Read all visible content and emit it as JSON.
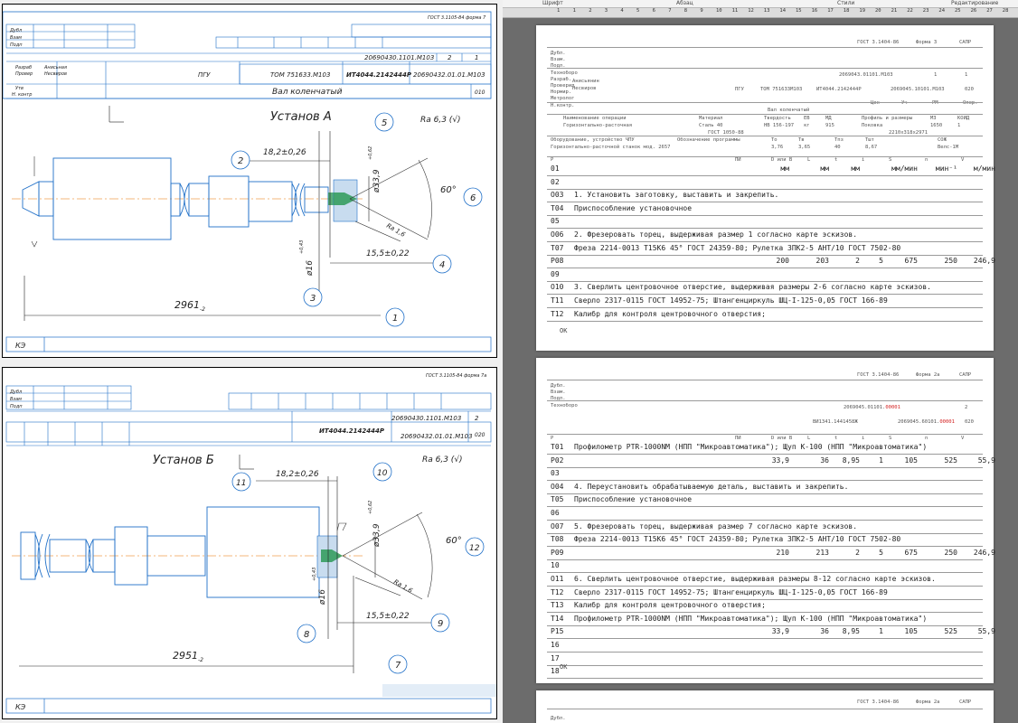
{
  "ribbon": {
    "groups": [
      "Шрифт",
      "Абзац",
      "Стили",
      "Редактирование"
    ]
  },
  "ruler": {
    "marks": [
      "1",
      "1",
      "2",
      "3",
      "4",
      "5",
      "6",
      "7",
      "8",
      "9",
      "10",
      "11",
      "12",
      "13",
      "14",
      "15",
      "16",
      "17",
      "18",
      "19",
      "20",
      "21",
      "22",
      "23",
      "24",
      "25",
      "26",
      "27",
      "28"
    ]
  },
  "sheet_a": {
    "gost": "ГОСТ 3.1105-84 форма 7",
    "stamp_left": [
      "Дубл",
      "Взам",
      "Подп"
    ],
    "doc_number": "20690430.1101.М103",
    "sheet_no": "2",
    "sheet_total": "1",
    "roles": [
      "Разраб",
      "Провер",
      "Утв",
      "Н. контр"
    ],
    "names": [
      "Анисьная",
      "Несвиров"
    ],
    "org": "ПГУ",
    "code1": "ТОМ 751633.М103",
    "code2": "ИТ4044.2142444Р",
    "code3": "20690432.01.01.М103",
    "part_name": "Вал коленчатый",
    "part_code": "010",
    "setup_title": "Установ А",
    "roughness": "Ra 6,3 (√)",
    "dims": {
      "d1": "18,2±0,26",
      "d2": "15,5±0,22",
      "d3": "2961",
      "d3_tol": "-2",
      "dia1": "ø33,9",
      "dia1_tol": "+0,62",
      "dia2": "ø16",
      "dia2_tol": "+0,43",
      "angle": "60°",
      "ra": "Ra 1,6"
    },
    "balloons": [
      "5",
      "2",
      "6",
      "4",
      "3",
      "1"
    ],
    "footer": "КЭ"
  },
  "sheet_b": {
    "gost": "ГОСТ 3.1105-84 форма 7а",
    "stamp_left": [
      "Дубл",
      "Взам",
      "Подп"
    ],
    "doc_number": "20690430.1101.М103",
    "sheet_no": "2",
    "code2": "ИТ4044.2142444Р",
    "code3": "20690432.01.01.М103",
    "part_code": "020",
    "setup_title": "Установ Б",
    "roughness": "Ra 6,3 (√)",
    "dims": {
      "d1": "18,2±0,26",
      "d2": "15,5±0,22",
      "d3": "2951",
      "d3_tol": "-2",
      "dia1": "ø33,9",
      "dia1_tol": "+0,62",
      "dia2": "ø16",
      "dia2_tol": "+0,43",
      "angle": "60°",
      "ra": "Ra 1,6"
    },
    "balloons": [
      "10",
      "11",
      "12",
      "9",
      "8",
      "7"
    ],
    "footer": "КЭ"
  },
  "doc_page1": {
    "header": {
      "gost": "ГОСТ 3.1404-86",
      "form": "Форма 3",
      "sapr": "САПР",
      "labels": [
        "Дубл.",
        "Взам.",
        "Подл.",
        "Техноборо",
        "Разраб.",
        "Проверил",
        "Нормир.",
        "Метролог",
        "Н.контр."
      ],
      "people": [
        "Анисьянин",
        "Несвиров"
      ],
      "doc_no": "2069043.01101.М103",
      "sheet": "1",
      "sheets": "1",
      "org": "ПГУ",
      "code1": "ТОМ 751633М103",
      "code2": "ИТ4044.2142444Р",
      "code3": "2069045.10101.М103",
      "op": "020",
      "part": "Вал коленчатый",
      "sub_labels": [
        "Цех",
        "Уч",
        "РМ",
        "Опер."
      ],
      "h1": [
        "Наименование операции",
        "Материал",
        "Твердость",
        "ЕВ",
        "МД",
        "Профиль и размеры",
        "МЗ",
        "КОИД"
      ],
      "v1": [
        "Горизонтально-расточная",
        "Сталь 40",
        "HB 156-197",
        "кг",
        "915",
        "Поковка",
        "1650",
        "1"
      ],
      "gost_mat": "ГОСТ 1050-88",
      "size": "2210x318x2971",
      "h2": [
        "Оборудование, устройство ЧПУ",
        "Обозначение программы",
        "То",
        "Тв",
        "Тпз",
        "Тшт",
        "СОЖ"
      ],
      "v2": [
        "Горизонтально-расточной станок мод. 2657",
        "",
        "3,76",
        "3,65",
        "40",
        "8,67",
        "Велс-1М"
      ],
      "cols": [
        "Р",
        "ПИ",
        "D или В",
        "L",
        "t",
        "i",
        "S",
        "n",
        "V"
      ]
    },
    "rows": [
      {
        "code": "01",
        "text": "",
        "vals": [
          "мм",
          "мм",
          "мм",
          "",
          "мм/мин",
          "мин⁻¹",
          "м/мин"
        ]
      },
      {
        "code": "02",
        "text": "",
        "vals": []
      },
      {
        "code": "О03",
        "text": "1. Установить заготовку, выставить и закрепить.",
        "vals": []
      },
      {
        "code": "Т04",
        "text": "Приспособление установочное",
        "vals": []
      },
      {
        "code": "05",
        "text": "",
        "vals": []
      },
      {
        "code": "О06",
        "text": "2. Фрезеровать торец, выдерживая размер 1 согласно карте эскизов.",
        "vals": []
      },
      {
        "code": "Т07",
        "text": "Фреза 2214-0013 Т15К6 45° ГОСТ 24359-80; Рулетка ЗПК2-5 АНТ/10 ГОСТ 7502-80",
        "vals": []
      },
      {
        "code": "Р08",
        "text": "",
        "vals": [
          "200",
          "203",
          "2",
          "5",
          "675",
          "250",
          "246,9"
        ]
      },
      {
        "code": "09",
        "text": "",
        "vals": []
      },
      {
        "code": "О10",
        "text": "3. Сверлить центровочное отверстие, выдерживая размеры 2-6 согласно карте эскизов.",
        "vals": []
      },
      {
        "code": "Т11",
        "text": "Сверло 2317-0115 ГОСТ 14952-75; Штангенциркуль ШЦ-I-125-0,05 ГОСТ 166-89",
        "vals": []
      },
      {
        "code": "Т12",
        "text": "Калибр для контроля центровочного отверстия;",
        "vals": []
      }
    ],
    "footer": "ОК"
  },
  "doc_page2": {
    "header": {
      "gost": "ГОСТ 3.1404-86",
      "form": "Форма 2а",
      "sapr": "САПР",
      "labels": [
        "Дубл.",
        "Взам.",
        "Подл.",
        "Техноборо"
      ],
      "doc_no_prefix": "2069045.01101.",
      "doc_no_red": "00001",
      "sheet": "2",
      "code2": "ВИ1341.1441458Ж",
      "code3_prefix": "2069045.60101.",
      "code3_red": "00001",
      "op": "020",
      "cols": [
        "Р",
        "ПИ",
        "D или В",
        "L",
        "t",
        "i",
        "S",
        "n",
        "V"
      ]
    },
    "rows": [
      {
        "code": "Т01",
        "text": "Профилометр PTR-1000NM (НПП \"Микроавтоматика\"); Щуп К-100 (НПП \"Микроавтоматика\")",
        "vals": []
      },
      {
        "code": "Р02",
        "text": "",
        "vals": [
          "33,9",
          "36",
          "8,95",
          "1",
          "105",
          "525",
          "55,9"
        ]
      },
      {
        "code": "03",
        "text": "",
        "vals": []
      },
      {
        "code": "О04",
        "text": "4. Переустановить обрабатываемую деталь, выставить и закрепить.",
        "vals": []
      },
      {
        "code": "Т05",
        "text": "Приспособление установочное",
        "vals": []
      },
      {
        "code": "06",
        "text": "",
        "vals": []
      },
      {
        "code": "О07",
        "text": "5. Фрезеровать торец, выдерживая размер 7 согласно карте эскизов.",
        "vals": []
      },
      {
        "code": "Т08",
        "text": "Фреза 2214-0013 Т15К6 45° ГОСТ 24359-80; Рулетка ЗПК2-5 АНТ/10 ГОСТ 7502-80",
        "vals": []
      },
      {
        "code": "Р09",
        "text": "",
        "vals": [
          "210",
          "213",
          "2",
          "5",
          "675",
          "250",
          "246,9"
        ]
      },
      {
        "code": "10",
        "text": "",
        "vals": []
      },
      {
        "code": "О11",
        "text": "6. Сверлить центровочное отверстие, выдерживая размеры 8-12 согласно карте эскизов.",
        "vals": []
      },
      {
        "code": "Т12",
        "text": "Сверло 2317-0115 ГОСТ 14952-75; Штангенциркуль ШЦ-I-125-0,05 ГОСТ 166-89",
        "vals": []
      },
      {
        "code": "Т13",
        "text": "Калибр для контроля центровочного отверстия;",
        "vals": []
      },
      {
        "code": "Т14",
        "text": "Профилометр PTR-1000NM (НПП \"Микроавтоматика\"); Щуп К-100 (НПП \"Микроавтоматика\")",
        "vals": []
      },
      {
        "code": "Р15",
        "text": "",
        "vals": [
          "33,9",
          "36",
          "8,95",
          "1",
          "105",
          "525",
          "55,9"
        ]
      },
      {
        "code": "16",
        "text": "",
        "vals": []
      },
      {
        "code": "17",
        "text": "",
        "vals": []
      },
      {
        "code": "18",
        "text": "",
        "vals": []
      }
    ],
    "footer": "ОК"
  },
  "doc_page3": {
    "gost": "ГОСТ 3.1404-86",
    "form": "Форма 2а",
    "sapr": "САПР",
    "label": "Дубл."
  }
}
